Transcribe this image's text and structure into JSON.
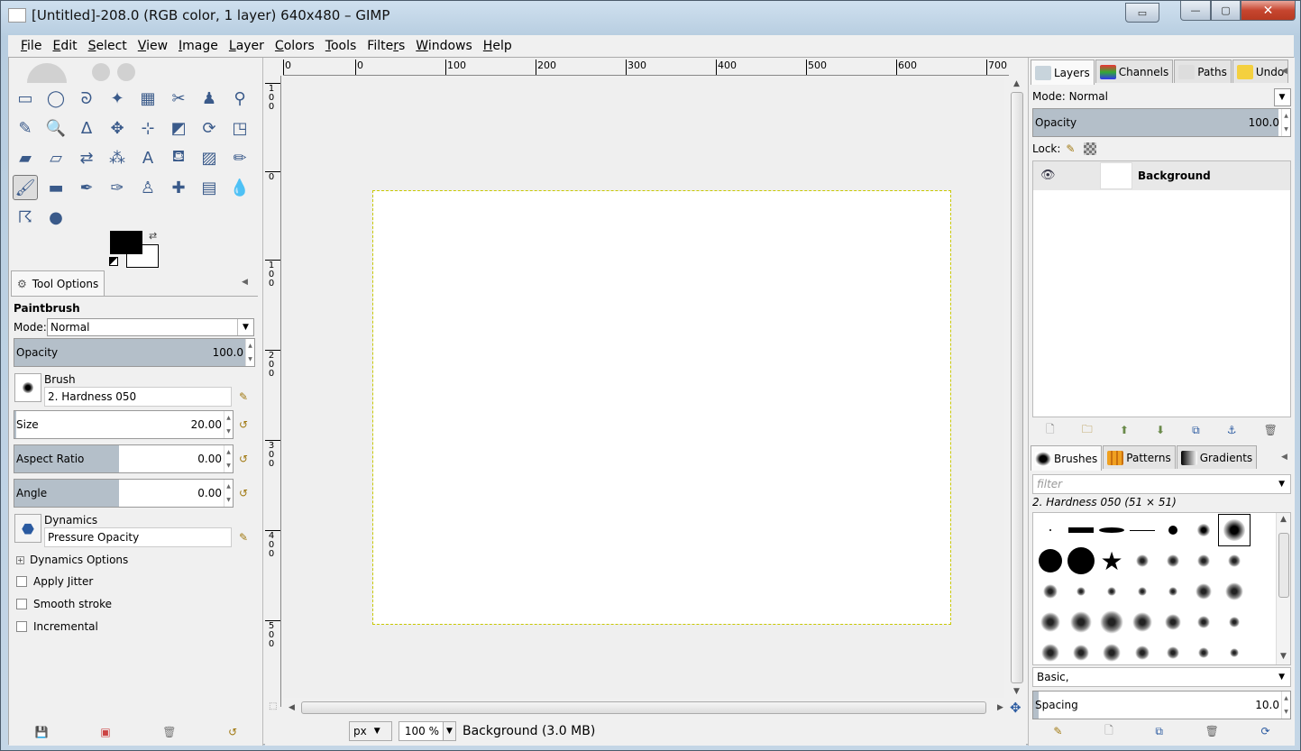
{
  "window": {
    "title": "[Untitled]-208.0 (RGB color, 1 layer) 640x480 – GIMP",
    "close_glyph": "✕",
    "min_glyph": "—",
    "max_glyph": "▢"
  },
  "menu": [
    "File",
    "Edit",
    "Select",
    "View",
    "Image",
    "Layer",
    "Colors",
    "Tools",
    "Filters",
    "Windows",
    "Help"
  ],
  "menu_mnemonics": [
    "F",
    "E",
    "S",
    "V",
    "I",
    "L",
    "C",
    "T",
    "r",
    "W",
    "H"
  ],
  "tools": [
    [
      "rect-select",
      "ellipse-select",
      "free-select",
      "fuzzy-select",
      "color-select",
      "scissors-select",
      "foreground-select",
      "paths"
    ],
    [
      "color-picker",
      "zoom",
      "measure",
      "move",
      "alignment",
      "crop",
      "rotate",
      "scale"
    ],
    [
      "shear",
      "perspective",
      "flip",
      "cage",
      "text",
      "bucket-fill",
      "blend",
      "pencil"
    ],
    [
      "paintbrush",
      "eraser",
      "airbrush",
      "ink",
      "clone",
      "heal",
      "perspective-clone",
      "blur"
    ],
    [
      "smudge",
      "dodge-burn"
    ]
  ],
  "tool_glyphs": [
    [
      "▭",
      "◯",
      "ᘐ",
      "✦",
      "▦",
      "✂",
      "♟",
      "⚲"
    ],
    [
      "✎",
      "🔍",
      "∆",
      "✥",
      "⊹",
      "◩",
      "⟳",
      "◳"
    ],
    [
      "▰",
      "▱",
      "⇄",
      "⁂",
      "A",
      "⛾",
      "▨",
      "✏"
    ],
    [
      "🖌",
      "▬",
      "✒",
      "✑",
      "♙",
      "✚",
      "▤",
      "💧"
    ],
    [
      "☈",
      "●"
    ]
  ],
  "active_tool": "paintbrush",
  "tool_options": {
    "tab_label": "Tool Options",
    "tool_name": "Paintbrush",
    "mode_label": "Mode:",
    "mode_value": "Normal",
    "opacity_label": "Opacity",
    "opacity_value": "100.0",
    "opacity_fraction": 1.0,
    "brush_label": "Brush",
    "brush_value": "2. Hardness 050",
    "size_label": "Size",
    "size_value": "20.00",
    "aspect_label": "Aspect Ratio",
    "aspect_value": "0.00",
    "angle_label": "Angle",
    "angle_value": "0.00",
    "dynamics_label": "Dynamics",
    "dynamics_value": "Pressure Opacity",
    "dynamics_options": "Dynamics Options",
    "apply_jitter": "Apply Jitter",
    "smooth_stroke": "Smooth stroke",
    "incremental": "Incremental"
  },
  "colors": {
    "foreground": "#000000",
    "background": "#ffffff",
    "accent": "#b4bfc9",
    "marching_ants": "#c8c800"
  },
  "ruler_h": [
    "0",
    "0",
    "100",
    "200",
    "300",
    "400",
    "500",
    "600",
    "700"
  ],
  "ruler_v": [
    "1\n0\n0",
    "0",
    "1\n0\n0",
    "2\n0\n0",
    "3\n0\n0",
    "4\n0\n0",
    "5\n0\n0"
  ],
  "status": {
    "unit": "px",
    "zoom": "100 %",
    "text": "Background (3.0 MB)"
  },
  "layers_dock": {
    "tabs": [
      "Layers",
      "Channels",
      "Paths",
      "Undo"
    ],
    "mode_label": "Mode:",
    "mode_value": "Normal",
    "opacity_label": "Opacity",
    "opacity_value": "100.0",
    "lock_label": "Lock:",
    "layer_name": "Background"
  },
  "brushes_dock": {
    "tabs": [
      "Brushes",
      "Patterns",
      "Gradients"
    ],
    "filter_placeholder": "filter",
    "selected_brush": "2. Hardness 050 (51 × 51)",
    "tag_value": "Basic,",
    "spacing_label": "Spacing",
    "spacing_value": "10.0"
  }
}
